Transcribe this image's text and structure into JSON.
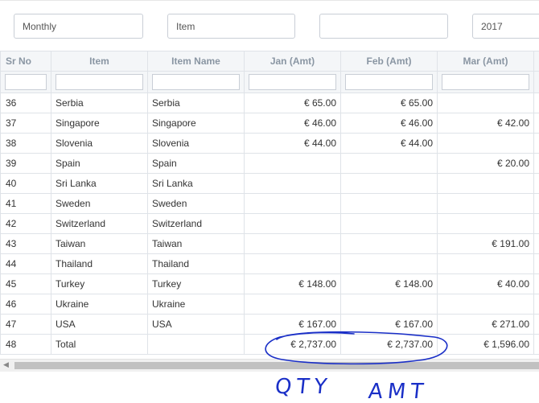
{
  "filters": {
    "period": "Monthly",
    "type": "Item",
    "blank": "",
    "year": "2017"
  },
  "columns": [
    "Sr No",
    "Item",
    "Item Name",
    "Jan (Amt)",
    "Feb (Amt)",
    "Mar (Amt)"
  ],
  "rows": [
    {
      "sr": "36",
      "item": "Serbia",
      "name": "Serbia",
      "jan": "€ 65.00",
      "feb": "€ 65.00",
      "mar": ""
    },
    {
      "sr": "37",
      "item": "Singapore",
      "name": "Singapore",
      "jan": "€ 46.00",
      "feb": "€ 46.00",
      "mar": "€ 42.00"
    },
    {
      "sr": "38",
      "item": "Slovenia",
      "name": "Slovenia",
      "jan": "€ 44.00",
      "feb": "€ 44.00",
      "mar": ""
    },
    {
      "sr": "39",
      "item": "Spain",
      "name": "Spain",
      "jan": "",
      "feb": "",
      "mar": "€ 20.00"
    },
    {
      "sr": "40",
      "item": "Sri Lanka",
      "name": "Sri Lanka",
      "jan": "",
      "feb": "",
      "mar": ""
    },
    {
      "sr": "41",
      "item": "Sweden",
      "name": "Sweden",
      "jan": "",
      "feb": "",
      "mar": ""
    },
    {
      "sr": "42",
      "item": "Switzerland",
      "name": "Switzerland",
      "jan": "",
      "feb": "",
      "mar": ""
    },
    {
      "sr": "43",
      "item": "Taiwan",
      "name": "Taiwan",
      "jan": "",
      "feb": "",
      "mar": "€ 191.00"
    },
    {
      "sr": "44",
      "item": "Thailand",
      "name": "Thailand",
      "jan": "",
      "feb": "",
      "mar": ""
    },
    {
      "sr": "45",
      "item": "Turkey",
      "name": "Turkey",
      "jan": "€ 148.00",
      "feb": "€ 148.00",
      "mar": "€ 40.00"
    },
    {
      "sr": "46",
      "item": "Ukraine",
      "name": "Ukraine",
      "jan": "",
      "feb": "",
      "mar": ""
    },
    {
      "sr": "47",
      "item": "USA",
      "name": "USA",
      "jan": "€ 167.00",
      "feb": "€ 167.00",
      "mar": "€ 271.00"
    },
    {
      "sr": "48",
      "item": "Total",
      "name": "",
      "jan": "€ 2,737.00",
      "feb": "€ 2,737.00",
      "mar": "€ 1,596.00"
    }
  ],
  "annotation": {
    "left_text": "QTY",
    "right_text": "AMT",
    "ink_color": "#1a2fc7"
  }
}
